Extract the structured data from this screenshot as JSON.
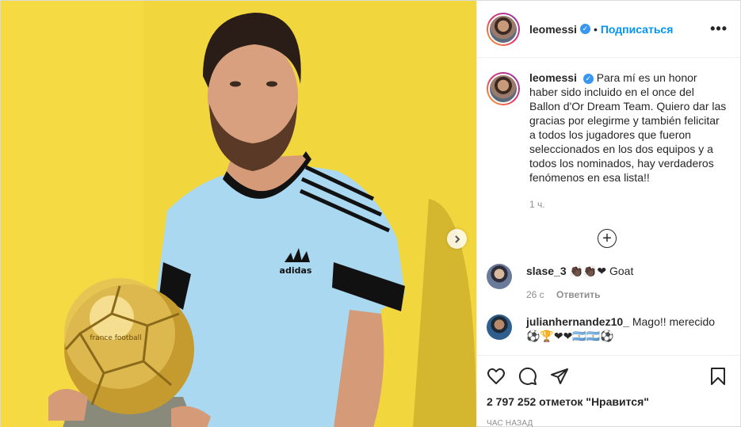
{
  "post": {
    "username": "leomessi",
    "verified_mark": "✓",
    "follow_label": "Подписаться",
    "more_label": "•••",
    "caption": "Para mí es un honor haber sido incluido en el once del Ballon d'Or Dream Team. Quiero dar las gracias por elegirme y también felicitar a todos los jugadores que fueron seleccionados en los dos equipos y a todos los nominados, hay verdaderos fenómenos en esa lista!!",
    "caption_time": "1 ч.",
    "load_more_label": "+",
    "likes": "2 797 252 отметок \"Нравится\"",
    "posted_ago": "час назад"
  },
  "media": {
    "shirt_logo": "adidas",
    "ball_logo": "france football",
    "next_icon": "chevron-right-icon"
  },
  "comments": [
    {
      "username": "slase_3",
      "text": "👏🏿👏🏿❤ Goat",
      "age": "26 с",
      "reply_label": "Ответить"
    },
    {
      "username": "julianhernandez10_",
      "text": "Mago!! merecido ⚽🏆❤❤🇦🇷🇦🇷⚽"
    }
  ],
  "icons": [
    "heart-icon",
    "comment-icon",
    "share-icon",
    "bookmark-icon"
  ],
  "colors": {
    "background": "#f0d43c",
    "accent": "#0095f6",
    "verified": "#3897f0"
  }
}
